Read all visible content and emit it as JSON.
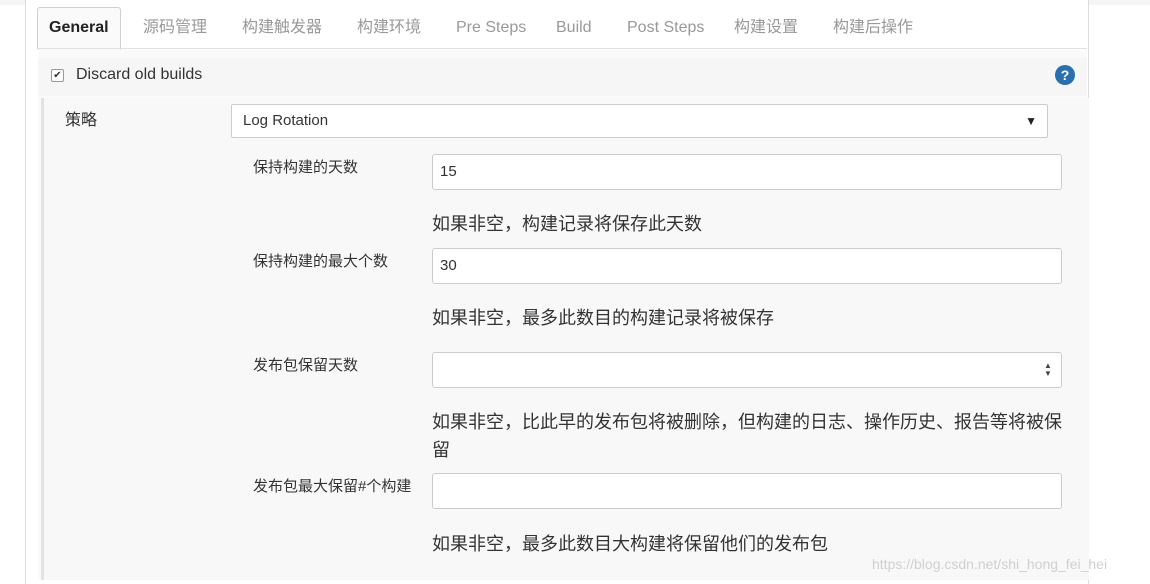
{
  "tabs": [
    {
      "label": "General",
      "active": true
    },
    {
      "label": "源码管理"
    },
    {
      "label": "构建触发器"
    },
    {
      "label": "构建环境"
    },
    {
      "label": "Pre Steps"
    },
    {
      "label": "Build"
    },
    {
      "label": "Post Steps"
    },
    {
      "label": "构建设置"
    },
    {
      "label": "构建后操作"
    }
  ],
  "discard": {
    "label": "Discard old builds",
    "checked": true,
    "help_icon": "question-icon"
  },
  "strategy": {
    "label": "策略",
    "selected": "Log Rotation"
  },
  "fields": [
    {
      "label": "保持构建的天数",
      "value": "15",
      "help": "如果非空，构建记录将保存此天数"
    },
    {
      "label": "保持构建的最大个数",
      "value": "30",
      "help": "如果非空，最多此数目的构建记录将被保存"
    },
    {
      "label": "发布包保留天数",
      "value": "",
      "help": "如果非空，比此早的发布包将被删除，但构建的日志、操作历史、报告等将被保留"
    },
    {
      "label": "发布包最大保留#个构建",
      "value": "",
      "help": "如果非空，最多此数目大构建将保留他们的发布包"
    }
  ],
  "watermark": "https://blog.csdn.net/shi_hong_fei_hei"
}
